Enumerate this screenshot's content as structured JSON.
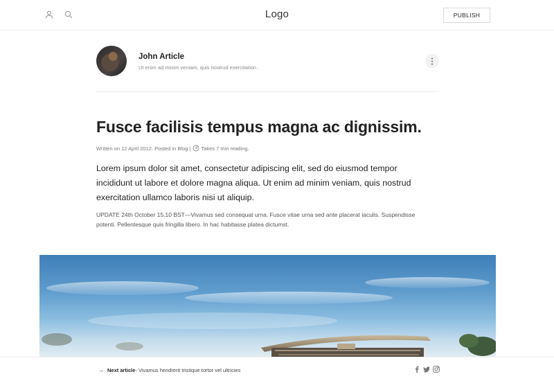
{
  "header": {
    "logo": "Logo",
    "publish_label": "PUBLISH",
    "icons": [
      "user-icon",
      "search-icon"
    ]
  },
  "author": {
    "name": "John Article",
    "bio": "Ut enim ad minim veniam, quis nostrud exercitation .",
    "more_icon": "more-vertical-icon"
  },
  "article": {
    "title": "Fusce facilisis tempus magna ac dignissim.",
    "meta_prefix": "Written on 12 April 2012. Posted in Blog |",
    "meta_reading": "Takes 7 min reading.",
    "lead": "Lorem ipsum dolor sit amet, consectetur adipiscing elit, sed do eiusmod tempor incididunt ut labore et dolore magna aliqua. Ut enim ad minim veniam, quis nostrud exercitation ullamco laboris nisi ut aliquip.",
    "update": "UPDATE 24th October 15.10 BST—Vivamus sed consequat urna. Fusce vitae urna sed ante placerat iaculis. Suspendisse potenti. Pellentesque quis fringilla libero. In hac habitasse platea dictumst."
  },
  "footer": {
    "next_label": "Next article",
    "next_title": " - Vivamus hendrerit tristique tortor vel ultricies",
    "social": [
      "facebook-icon",
      "twitter-icon",
      "instagram-icon"
    ]
  },
  "colors": {
    "text": "#222222",
    "muted": "#888888",
    "border": "#eeeeee",
    "sky": "#5f9ccd"
  }
}
